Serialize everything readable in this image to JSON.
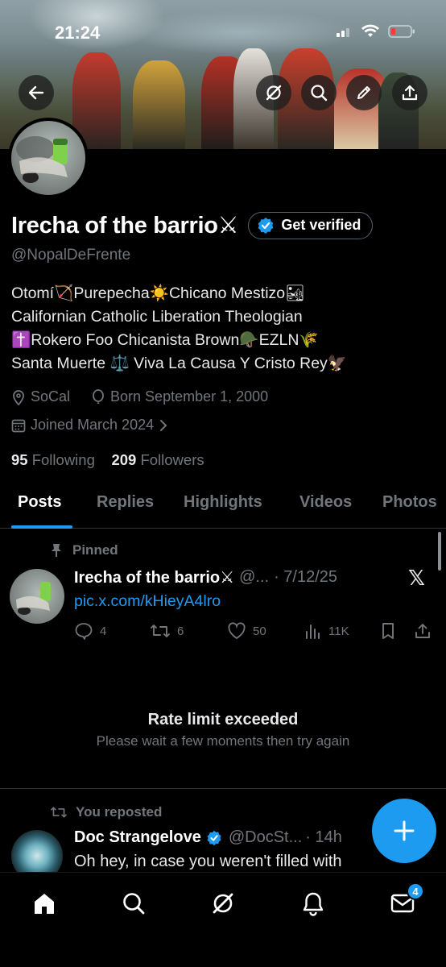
{
  "status_bar": {
    "time": "21:24"
  },
  "profile": {
    "display_name": "Irecha of the barrio⚔",
    "get_verified_label": "Get verified",
    "handle": "@NopalDeFrente",
    "bio_lines": [
      "Otomí🏹Purepecha☀️Chicano Mestizo🏜",
      "Californian Catholic Liberation Theologian",
      "✝️Rokero Foo Chicanista Brown🪖EZLN🌾",
      "Santa Muerte ⚖️ Viva La Causa Y Cristo Rey🦅"
    ],
    "location": "SoCal",
    "born": "Born September 1, 2000",
    "joined": "Joined March 2024",
    "following_count": "95",
    "following_label": "Following",
    "followers_count": "209",
    "followers_label": "Followers"
  },
  "tabs": [
    {
      "label": "Posts"
    },
    {
      "label": "Replies"
    },
    {
      "label": "Highlights"
    },
    {
      "label": "Videos"
    },
    {
      "label": "Photos"
    }
  ],
  "pinned_post": {
    "pinned_label": "Pinned",
    "author_name": "Irecha of the barrio⚔",
    "author_handle": "@...",
    "date": "· 7/12/25",
    "link": "pic.x.com/kHieyA4lro",
    "replies": "4",
    "reposts": "6",
    "likes": "50",
    "views": "11K"
  },
  "rate_limit": {
    "title": "Rate limit exceeded",
    "subtitle": "Please wait a few moments then try again"
  },
  "reposted_post": {
    "repost_label": "You reposted",
    "author_name": "Doc Strangelove",
    "author_handle": "@DocSt...",
    "time": "· 14h",
    "text": "Oh hey, in case you weren't filled with"
  },
  "nav": {
    "messages_badge": "4"
  },
  "colors": {
    "accent": "#1d9bf0",
    "background": "#000000",
    "muted": "#71767b"
  }
}
